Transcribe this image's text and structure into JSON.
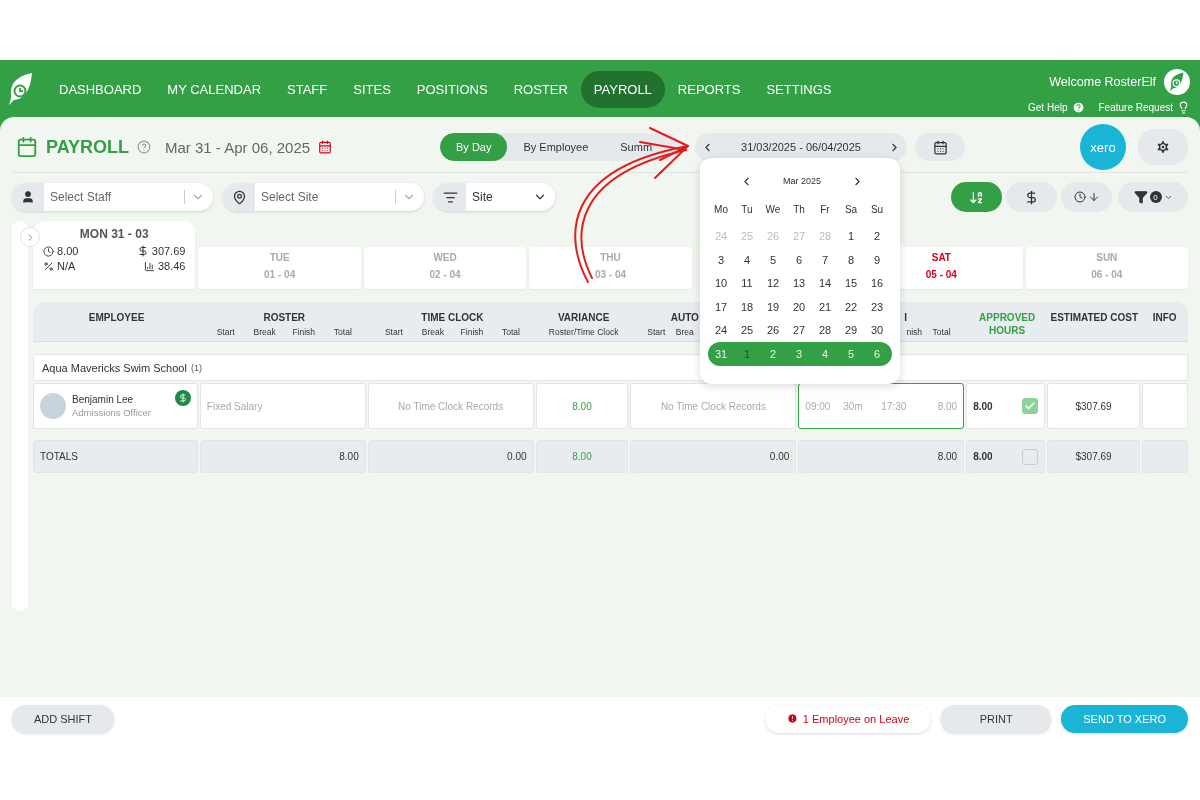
{
  "nav": {
    "items": [
      {
        "label": "DASHBOARD",
        "selected": false
      },
      {
        "label": "MY CALENDAR",
        "selected": false
      },
      {
        "label": "STAFF",
        "selected": false
      },
      {
        "label": "SITES",
        "selected": false
      },
      {
        "label": "POSITIONS",
        "selected": false
      },
      {
        "label": "ROSTER",
        "selected": false
      },
      {
        "label": "PAYROLL",
        "selected": true
      },
      {
        "label": "REPORTS",
        "selected": false
      },
      {
        "label": "SETTINGS",
        "selected": false
      }
    ],
    "welcome": "Welcome RosterElf",
    "links": [
      {
        "label": "Get Help",
        "kind": "help"
      },
      {
        "label": "Feature Request",
        "kind": "idea"
      }
    ]
  },
  "header": {
    "title": "PAYROLL",
    "date_range": "Mar 31 - Apr 06, 2025",
    "views": [
      {
        "label": "By Day",
        "selected": true
      },
      {
        "label": "By Employee",
        "selected": false
      },
      {
        "label": "Summ",
        "selected": false
      }
    ],
    "period": "31/03/2025 - 06/04/2025",
    "xero": "xero"
  },
  "filters": [
    {
      "kind": "staff",
      "placeholder": "Select Staff"
    },
    {
      "kind": "site",
      "placeholder": "Select Site"
    },
    {
      "kind": "group",
      "value": "Site"
    }
  ],
  "tools": [
    {
      "kind": "sort-az",
      "selected": true
    },
    {
      "kind": "cost",
      "selected": false
    },
    {
      "kind": "time-sort",
      "selected": false
    },
    {
      "kind": "filter",
      "selected": false,
      "badge": "0"
    }
  ],
  "calendar": {
    "month": "Mar 2025",
    "weekdays": [
      "Mo",
      "Tu",
      "We",
      "Th",
      "Fr",
      "Sa",
      "Su"
    ],
    "weeks": [
      {
        "selected": false,
        "days": [
          {
            "day": "24",
            "muted": true
          },
          {
            "day": "25",
            "muted": true
          },
          {
            "day": "26",
            "muted": true
          },
          {
            "day": "27",
            "muted": true
          },
          {
            "day": "28",
            "muted": true
          },
          {
            "day": "1",
            "muted": false
          },
          {
            "day": "2",
            "muted": false
          }
        ]
      },
      {
        "selected": false,
        "days": [
          {
            "day": "3",
            "muted": false
          },
          {
            "day": "4",
            "muted": false
          },
          {
            "day": "5",
            "muted": false
          },
          {
            "day": "6",
            "muted": false
          },
          {
            "day": "7",
            "muted": false
          },
          {
            "day": "8",
            "muted": false
          },
          {
            "day": "9",
            "muted": false
          }
        ]
      },
      {
        "selected": false,
        "days": [
          {
            "day": "10",
            "muted": false
          },
          {
            "day": "11",
            "muted": false
          },
          {
            "day": "12",
            "muted": false
          },
          {
            "day": "13",
            "muted": false
          },
          {
            "day": "14",
            "muted": false
          },
          {
            "day": "15",
            "muted": false
          },
          {
            "day": "16",
            "muted": false
          }
        ]
      },
      {
        "selected": false,
        "days": [
          {
            "day": "17",
            "muted": false
          },
          {
            "day": "18",
            "muted": false
          },
          {
            "day": "19",
            "muted": false
          },
          {
            "day": "20",
            "muted": false
          },
          {
            "day": "21",
            "muted": false
          },
          {
            "day": "22",
            "muted": false
          },
          {
            "day": "23",
            "muted": false
          }
        ]
      },
      {
        "selected": false,
        "days": [
          {
            "day": "24",
            "muted": false
          },
          {
            "day": "25",
            "muted": false
          },
          {
            "day": "26",
            "muted": false
          },
          {
            "day": "27",
            "muted": false
          },
          {
            "day": "28",
            "muted": false
          },
          {
            "day": "29",
            "muted": false
          },
          {
            "day": "30",
            "muted": false
          }
        ]
      },
      {
        "selected": true,
        "days": [
          {
            "day": "31",
            "muted": false
          },
          {
            "day": "1",
            "muted": true
          },
          {
            "day": "2",
            "muted": false
          },
          {
            "day": "3",
            "muted": false
          },
          {
            "day": "4",
            "muted": false
          },
          {
            "day": "5",
            "muted": false
          },
          {
            "day": "6",
            "muted": false
          }
        ]
      }
    ]
  },
  "days": [
    {
      "weekday": "MON",
      "date": "31 - 03",
      "selected": true,
      "alert": false,
      "stats": [
        {
          "kind": "hours",
          "value": "8.00"
        },
        {
          "kind": "cost",
          "value": "307.69"
        },
        {
          "kind": "percent",
          "value": "N/A"
        },
        {
          "kind": "chart",
          "value": "38.46"
        }
      ]
    },
    {
      "weekday": "TUE",
      "date": "01 - 04",
      "selected": false,
      "alert": false
    },
    {
      "weekday": "WED",
      "date": "02 - 04",
      "selected": false,
      "alert": false
    },
    {
      "weekday": "THU",
      "date": "03 - 04",
      "selected": false,
      "alert": false
    },
    {
      "weekday": "SAT",
      "date": "05 - 04",
      "selected": false,
      "alert": true
    },
    {
      "weekday": "SUN",
      "date": "06 - 04",
      "selected": false,
      "alert": false
    }
  ],
  "table": {
    "columns": [
      {
        "title": "EMPLOYEE",
        "highlight": false
      },
      {
        "title": "ROSTER",
        "subs": [
          "Start",
          "Break",
          "Finish",
          "Total"
        ],
        "highlight": false
      },
      {
        "title": "TIME CLOCK",
        "subs": [
          "Start",
          "Break",
          "Finish",
          "Total"
        ],
        "highlight": false
      },
      {
        "title": "VARIANCE",
        "subs": [
          "Roster/Time Clock"
        ],
        "highlight": false
      },
      {
        "title": "AUTO",
        "subs": [
          "Start",
          "Brea"
        ],
        "highlight": false
      },
      {
        "title": "I",
        "subs": [
          "nish",
          "Total"
        ],
        "highlight": false
      },
      {
        "title": "APPROVED HOURS",
        "highlight": true
      },
      {
        "title": "ESTIMATED COST",
        "highlight": false
      },
      {
        "title": "INFO",
        "highlight": false
      }
    ],
    "groups": [
      {
        "name": "Aqua Mavericks Swim School",
        "count": "(1)",
        "rows": [
          {
            "name": "Benjamin Lee",
            "role": "Admissions Officer",
            "salaried": true,
            "roster": "Fixed Salary",
            "time_clock": "No Time Clock Records",
            "variance": "8.00",
            "auto": "No Time Clock Records",
            "approved_shift": [
              "09:00",
              "30m",
              "17:30",
              "8.00"
            ],
            "approved_hours": "8.00",
            "approved": true,
            "cost": "$307.69"
          }
        ]
      }
    ],
    "totals": {
      "label": "TOTALS",
      "roster": "8.00",
      "time_clock": "0.00",
      "variance": "8.00",
      "auto": "0.00",
      "approved_shift": "8.00",
      "approved_hours": "8.00",
      "approved": false,
      "cost": "$307.69"
    }
  },
  "footer": {
    "add": "ADD SHIFT",
    "leave": "1 Employee on Leave",
    "print": "PRINT",
    "send": "SEND TO XERO"
  }
}
